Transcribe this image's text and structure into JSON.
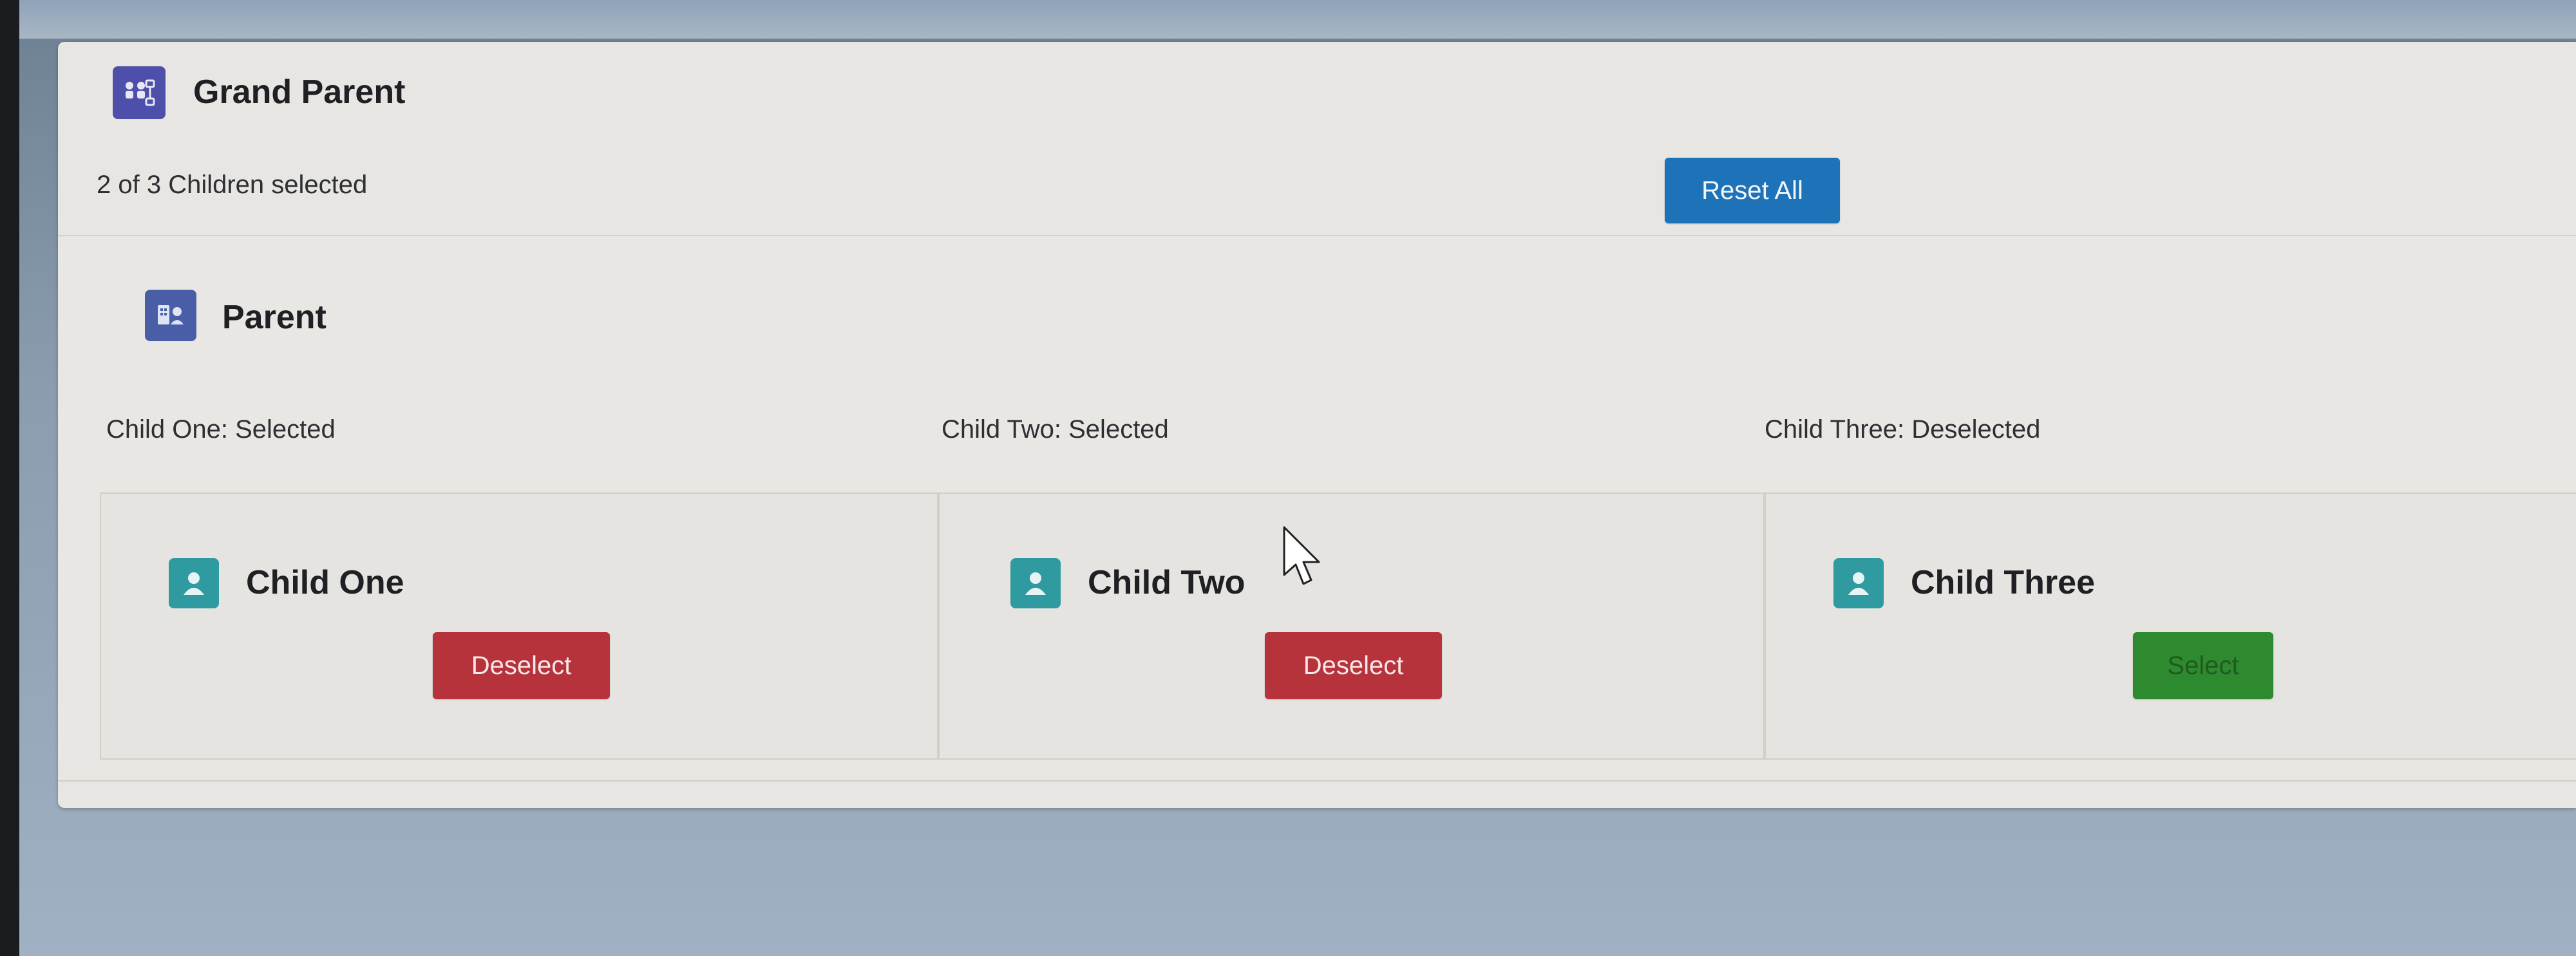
{
  "grand_parent": {
    "title": "Grand Parent",
    "icon": "hierarchy-icon",
    "status": "2 of 3 Children selected",
    "reset_label": "Reset All"
  },
  "parent": {
    "title": "Parent",
    "icon": "groups-icon"
  },
  "children": [
    {
      "status": "Child One: Selected",
      "title": "Child One",
      "button_label": "Deselect",
      "selected": true,
      "icon": "user-icon"
    },
    {
      "status": "Child Two: Selected",
      "title": "Child Two",
      "button_label": "Deselect",
      "selected": true,
      "icon": "user-icon"
    },
    {
      "status": "Child Three: Deselected",
      "title": "Child Three",
      "button_label": "Select",
      "selected": false,
      "icon": "user-icon"
    }
  ],
  "colors": {
    "brand_button": "#1d72b8",
    "deselect_button": "#b6333b",
    "select_button": "#2e8a2e",
    "gp_icon_bg": "#4d4faa",
    "parent_icon_bg": "#4a5ea8",
    "child_icon_bg": "#2f9aa0"
  }
}
